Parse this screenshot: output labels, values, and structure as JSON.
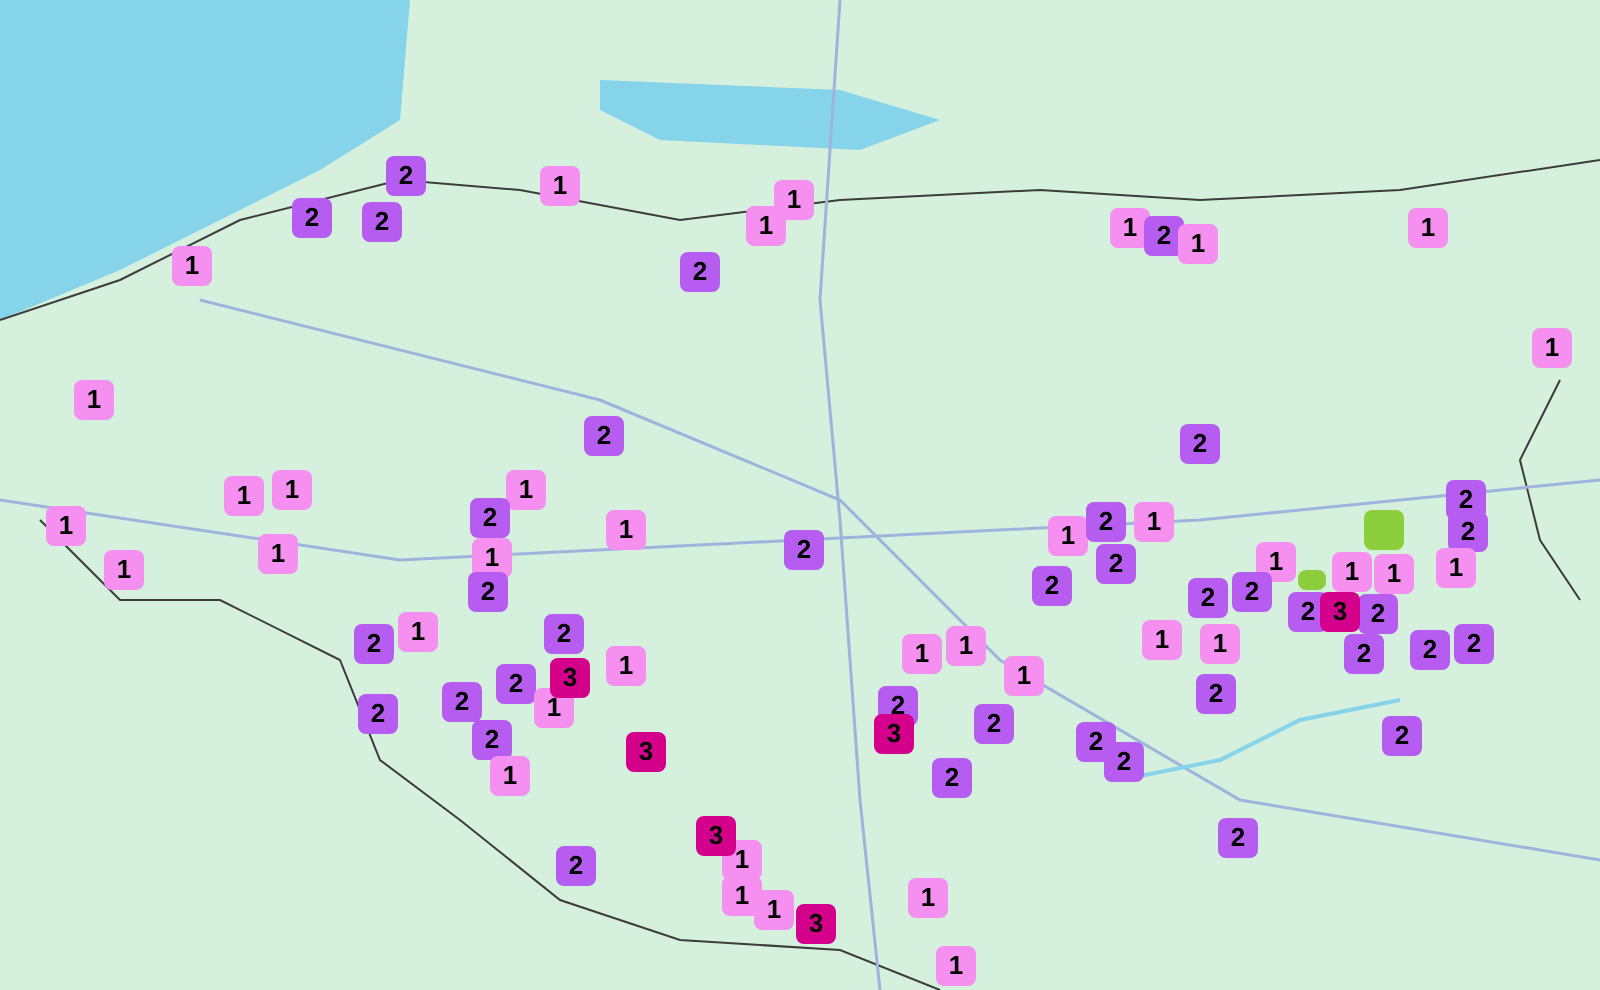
{
  "markers": [
    {
      "label": "2",
      "color": "#b65cf0"
    },
    {
      "label": "1",
      "color": "#f590f0"
    },
    {
      "label": "1",
      "color": "#f590f0"
    },
    {
      "label": "2",
      "color": "#b65cf0"
    },
    {
      "label": "2",
      "color": "#b65cf0"
    },
    {
      "label": "1",
      "color": "#f590f0"
    },
    {
      "label": "1",
      "color": "#f590f0"
    },
    {
      "label": "2",
      "color": "#b65cf0"
    },
    {
      "label": "1",
      "color": "#f590f0"
    },
    {
      "label": "1",
      "color": "#f590f0"
    },
    {
      "label": "1",
      "color": "#f590f0"
    },
    {
      "label": "2",
      "color": "#b65cf0"
    },
    {
      "label": "1",
      "color": "#f590f0"
    },
    {
      "label": "1",
      "color": "#f590f0"
    },
    {
      "label": "2",
      "color": "#b65cf0"
    },
    {
      "label": "2",
      "color": "#b65cf0"
    },
    {
      "label": "1",
      "color": "#f590f0"
    },
    {
      "label": "1",
      "color": "#f590f0"
    },
    {
      "label": "1",
      "color": "#f590f0"
    },
    {
      "label": "2",
      "color": "#b65cf0"
    },
    {
      "label": "1",
      "color": "#f590f0"
    },
    {
      "label": "2",
      "color": "#b65cf0"
    },
    {
      "label": "1",
      "color": "#f590f0"
    },
    {
      "label": "1",
      "color": "#f590f0"
    },
    {
      "label": "2",
      "color": "#b65cf0"
    },
    {
      "label": "1",
      "color": "#f590f0"
    },
    {
      "color": "#8ccf3c"
    },
    {
      "label": "2",
      "color": "#b65cf0"
    },
    {
      "label": "1",
      "color": "#f590f0"
    },
    {
      "label": "1",
      "color": "#f590f0"
    },
    {
      "label": "1",
      "color": "#f590f0"
    },
    {
      "label": "2",
      "color": "#b65cf0"
    },
    {
      "label": "2",
      "color": "#b65cf0"
    },
    {
      "label": "1",
      "color": "#f590f0"
    },
    {
      "label": "1",
      "color": "#f590f0"
    },
    {
      "label": "1",
      "color": "#f590f0"
    },
    {
      "label": "1",
      "color": "#f590f0"
    },
    {
      "label": "2",
      "color": "#b65cf0"
    },
    {
      "label": "2",
      "color": "#b65cf0"
    },
    {
      "label": "2",
      "color": "#b65cf0"
    },
    {
      "label": "2",
      "color": "#b65cf0"
    },
    {
      "color": "#8ccf3c"
    },
    {
      "label": "2",
      "color": "#b65cf0"
    },
    {
      "label": "3",
      "color": "#d4008c"
    },
    {
      "label": "2",
      "color": "#b65cf0"
    },
    {
      "label": "2",
      "color": "#b65cf0"
    },
    {
      "label": "1",
      "color": "#f590f0"
    },
    {
      "label": "2",
      "color": "#b65cf0"
    },
    {
      "label": "1",
      "color": "#f590f0"
    },
    {
      "label": "1",
      "color": "#f590f0"
    },
    {
      "label": "1",
      "color": "#f590f0"
    },
    {
      "label": "1",
      "color": "#f590f0"
    },
    {
      "label": "2",
      "color": "#b65cf0"
    },
    {
      "label": "2",
      "color": "#b65cf0"
    },
    {
      "label": "2",
      "color": "#b65cf0"
    },
    {
      "label": "2",
      "color": "#b65cf0"
    },
    {
      "label": "3",
      "color": "#d4008c"
    },
    {
      "label": "1",
      "color": "#f590f0"
    },
    {
      "label": "1",
      "color": "#f590f0"
    },
    {
      "label": "2",
      "color": "#b65cf0"
    },
    {
      "label": "2",
      "color": "#b65cf0"
    },
    {
      "label": "1",
      "color": "#f590f0"
    },
    {
      "label": "2",
      "color": "#b65cf0"
    },
    {
      "label": "2",
      "color": "#b65cf0"
    },
    {
      "label": "2",
      "color": "#b65cf0"
    },
    {
      "label": "3",
      "color": "#d4008c"
    },
    {
      "label": "2",
      "color": "#b65cf0"
    },
    {
      "label": "2",
      "color": "#b65cf0"
    },
    {
      "label": "2",
      "color": "#b65cf0"
    },
    {
      "label": "1",
      "color": "#f590f0"
    },
    {
      "label": "3",
      "color": "#d4008c"
    },
    {
      "label": "2",
      "color": "#b65cf0"
    },
    {
      "label": "2",
      "color": "#b65cf0"
    },
    {
      "label": "3",
      "color": "#d4008c"
    },
    {
      "label": "2",
      "color": "#b65cf0"
    },
    {
      "label": "2",
      "color": "#b65cf0"
    },
    {
      "label": "1",
      "color": "#f590f0"
    },
    {
      "label": "1",
      "color": "#f590f0"
    },
    {
      "label": "1",
      "color": "#f590f0"
    },
    {
      "label": "3",
      "color": "#d4008c"
    },
    {
      "label": "1",
      "color": "#f590f0"
    },
    {
      "label": "1",
      "color": "#f590f0"
    }
  ]
}
